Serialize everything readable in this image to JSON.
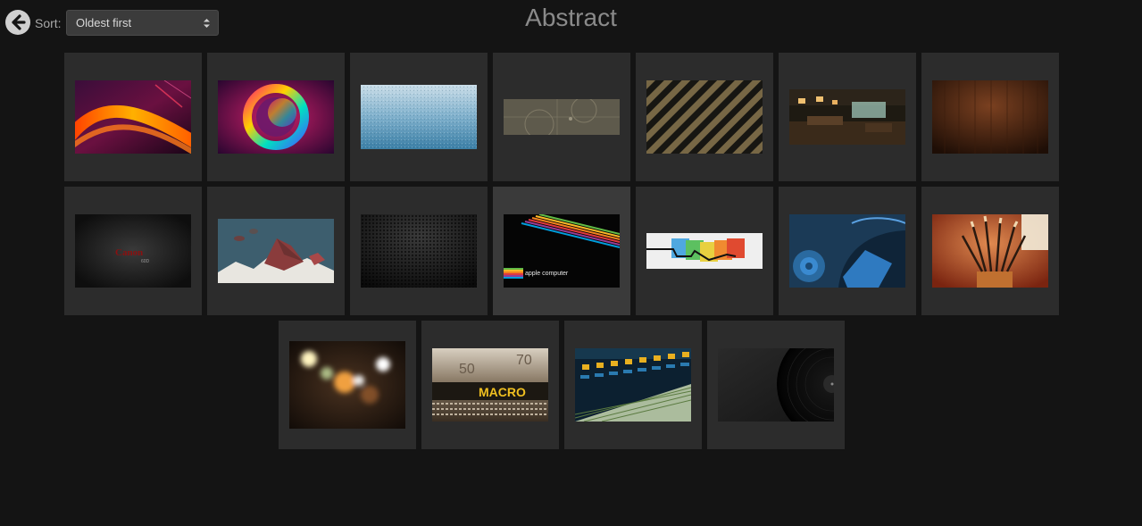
{
  "header": {
    "title": "Abstract",
    "sort_label": "Sort:",
    "sort_value": "Oldest first",
    "back_icon": "arrow-left-circle-icon"
  },
  "wallpapers": [
    {
      "id": "orange-waves",
      "theme": "orange light streaks"
    },
    {
      "id": "neon-circle",
      "theme": "glowing rainbow circle"
    },
    {
      "id": "blue-grain",
      "theme": "blue grain gradient"
    },
    {
      "id": "beige-circles",
      "theme": "beige line art"
    },
    {
      "id": "diagonal-stripes",
      "theme": "black and gold stripes"
    },
    {
      "id": "dark-room",
      "theme": "dim interior"
    },
    {
      "id": "brown-wood",
      "theme": "dark wood"
    },
    {
      "id": "canon-dark",
      "theme": "canon logo on black"
    },
    {
      "id": "low-poly-islands",
      "theme": "floating low-poly islands"
    },
    {
      "id": "carbon-mesh",
      "theme": "dark mesh"
    },
    {
      "id": "apple-rainbow",
      "theme": "apple computer rainbow stripes"
    },
    {
      "id": "color-blocks",
      "theme": "colored 3d blocks"
    },
    {
      "id": "blue-speaker",
      "theme": "blue speaker"
    },
    {
      "id": "paint-brushes",
      "theme": "paint brushes"
    },
    {
      "id": "bokeh-lights",
      "theme": "bokeh lights"
    },
    {
      "id": "macro-lens",
      "theme": "macro lens"
    },
    {
      "id": "mixing-console",
      "theme": "mixing console"
    },
    {
      "id": "vinyl-record",
      "theme": "vinyl record"
    }
  ],
  "thumb_texts": {
    "canon": "Canon",
    "canon_sub": "60D",
    "apple": "apple computer",
    "macro": "MACRO",
    "lens_50": "50",
    "lens_70": "70"
  }
}
